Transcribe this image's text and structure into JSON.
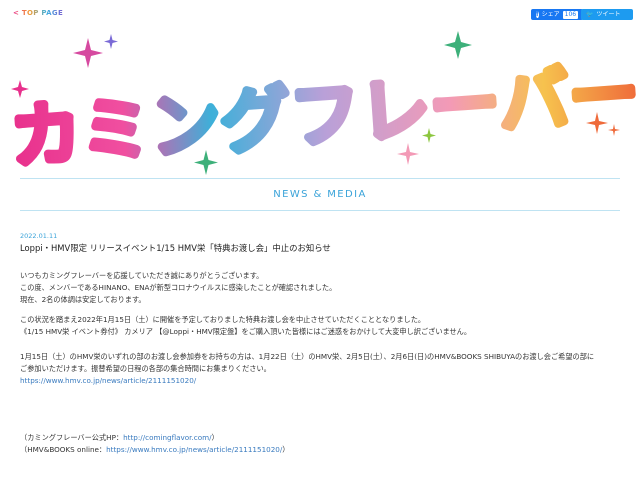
{
  "nav": {
    "top_page": "< TOP PAGE"
  },
  "share": {
    "facebook_label": "シェア",
    "facebook_count": "106",
    "twitter_label": "ツイート"
  },
  "hero": {
    "logo_text": "カミングフレーバー"
  },
  "section": {
    "title": "NEWS & MEDIA"
  },
  "article": {
    "date": "2022.01.11",
    "title": "Loppi・HMV限定 リリースイベント1/15 HMV栄「特典お渡し会」中止のお知らせ",
    "p1": [
      "いつもカミングフレーバーを応援していただき誠にありがとうございます。",
      "この度、メンバーであるHINANO、ENAが新型コロナウイルスに感染したことが確認されました。",
      "現在、2名の体調は安定しております。"
    ],
    "p2": [
      "この状況を踏まえ2022年1月15日（土）に開催を予定しておりました特典お渡し会を中止させていただくこととなりました。",
      "《1/15 HMV栄 イベント券付》 カメリア 【@Loppi・HMV限定盤】をご購入頂いた皆様にはご迷惑をおかけして大変申し訳ございません。"
    ],
    "p3": [
      "1月15日（土）のHMV栄のいずれの部のお渡し会参加券をお持ちの方は、1月22日（土）のHMV栄、2月5日(土）、2月6日(日)のHMV&BOOKS SHIBUYAのお渡し会ご希望の部に",
      "ご参加いただけます。振替希望の日程の各部の集合時間にお集まりください。"
    ],
    "p3_link": "https://www.hmv.co.jp/news/article/2111151020/",
    "p4_line1_prefix": "（カミングフレーバー公式HP：",
    "p4_line1_link": "http://comingflavor.com/",
    "p4_line1_suffix": "）",
    "p4_line2_prefix": "（HMV&BOOKS online：",
    "p4_line2_link": "https://www.hmv.co.jp/news/article/2111151020/",
    "p4_line2_suffix": "）"
  },
  "colors": {
    "accent": "#3aa3d9",
    "facebook": "#1877f2",
    "twitter": "#1d9bf0",
    "link": "#3a7bbf"
  }
}
